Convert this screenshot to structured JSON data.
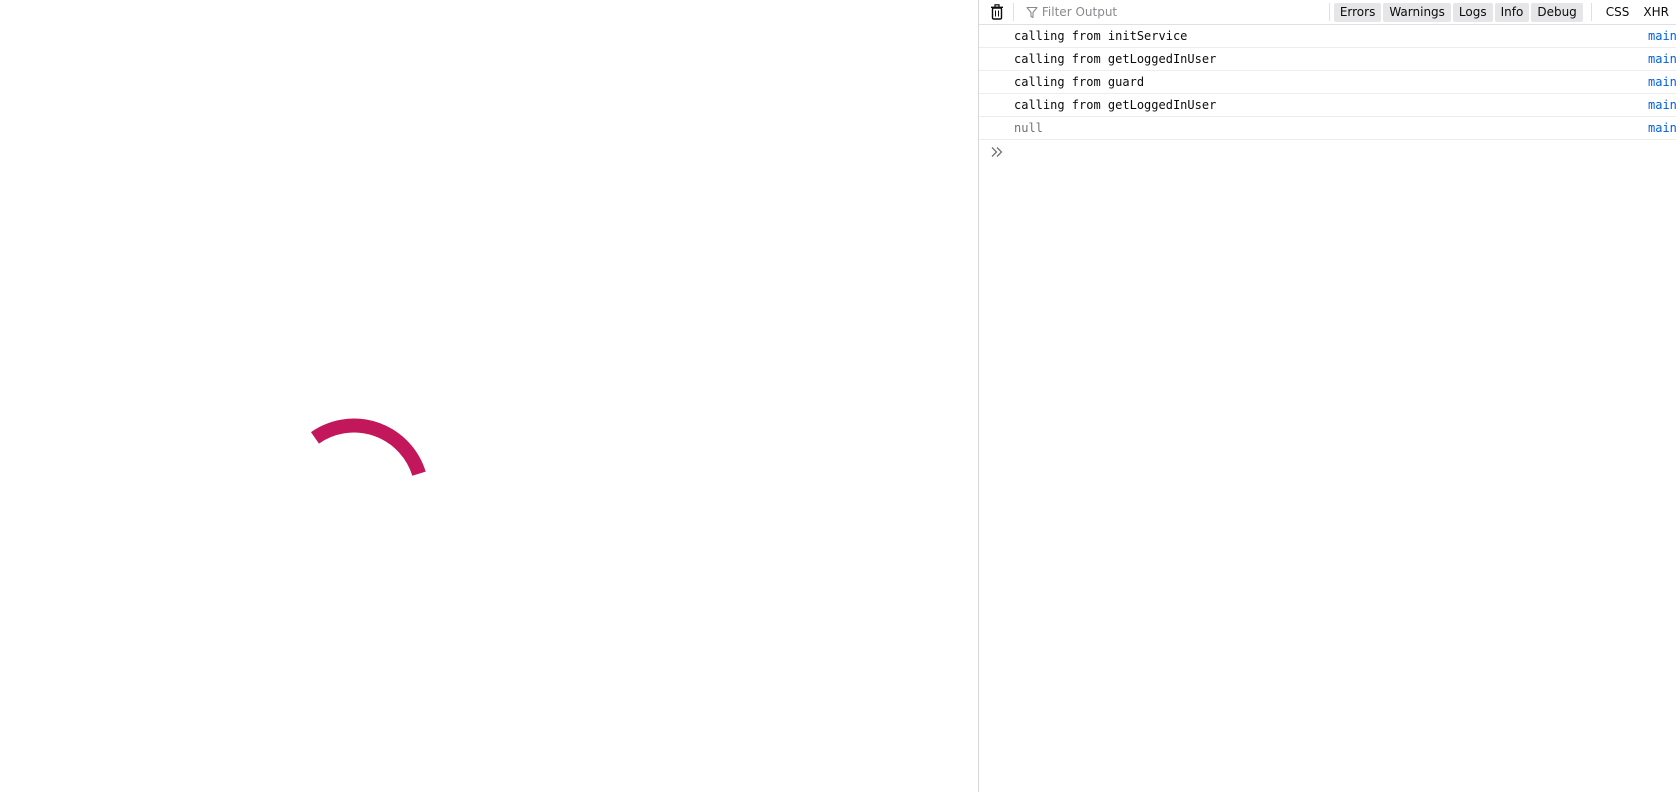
{
  "app": {
    "spinner_color": "#c2185b"
  },
  "console": {
    "toolbar": {
      "clear_icon": "trash-icon",
      "filter_icon": "funnel-icon",
      "filter_placeholder": "Filter Output",
      "levels": [
        "Errors",
        "Warnings",
        "Logs",
        "Info",
        "Debug"
      ],
      "types": [
        "CSS",
        "XHR"
      ]
    },
    "messages": [
      {
        "text": "calling from initService",
        "source": "main"
      },
      {
        "text": "calling from getLoggedInUser",
        "source": "main"
      },
      {
        "text": "calling from guard",
        "source": "main"
      },
      {
        "text": "calling from getLoggedInUser",
        "source": "main"
      },
      {
        "text": "null",
        "source": "main"
      }
    ],
    "prompt_icon": "double-chevron-right-icon",
    "prompt_value": ""
  }
}
